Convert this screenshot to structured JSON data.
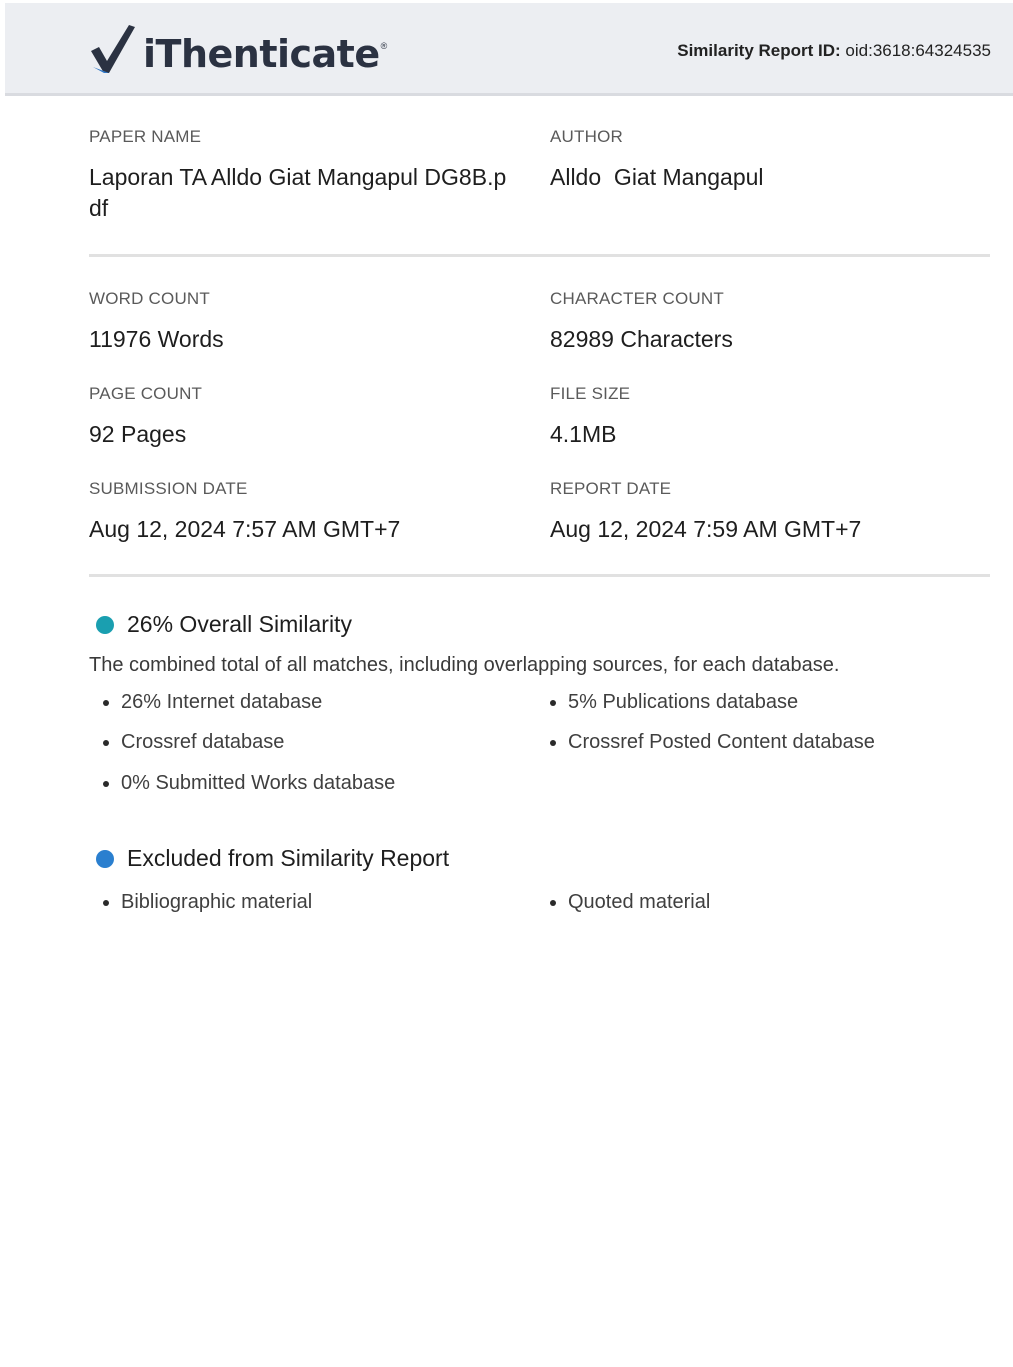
{
  "header": {
    "brand": "iThenticate",
    "registered": "®",
    "report_id_label": "Similarity Report ID:",
    "report_id_value": "oid:3618:64324535"
  },
  "meta": {
    "paper_name_label": "PAPER NAME",
    "paper_name_line1": "Laporan TA Alldo Giat Mangapul DG8B.p",
    "paper_name_line2": "df",
    "author_label": "AUTHOR",
    "author_value": "Alldo  Giat Mangapul",
    "word_count_label": "WORD COUNT",
    "word_count_value": "11976 Words",
    "char_count_label": "CHARACTER COUNT",
    "char_count_value": "82989 Characters",
    "page_count_label": "PAGE COUNT",
    "page_count_value": "92 Pages",
    "file_size_label": "FILE SIZE",
    "file_size_value": "4.1MB",
    "submission_label": "SUBMISSION DATE",
    "submission_value": "Aug 12, 2024 7:57 AM GMT+7",
    "report_date_label": "REPORT DATE",
    "report_date_value": "Aug 12, 2024 7:59 AM GMT+7"
  },
  "similarity": {
    "title": "26% Overall Similarity",
    "description": "The combined total of all matches, including overlapping sources, for each database.",
    "dot_color": "#1a9fb0",
    "left_items": [
      "26% Internet database",
      "Crossref database",
      "0% Submitted Works database"
    ],
    "right_items": [
      "5% Publications database",
      "Crossref Posted Content database"
    ]
  },
  "excluded": {
    "title": "Excluded from Similarity Report",
    "dot_color": "#2a7fcf",
    "left_items": [
      "Bibliographic material"
    ],
    "right_items": [
      "Quoted material"
    ]
  },
  "colors": {
    "header_bg": "#eceef2",
    "logo_check": "#2b3242",
    "logo_check_accent": "#2f76c4"
  },
  "icons": {
    "logo": "checkmark-logo-icon"
  }
}
